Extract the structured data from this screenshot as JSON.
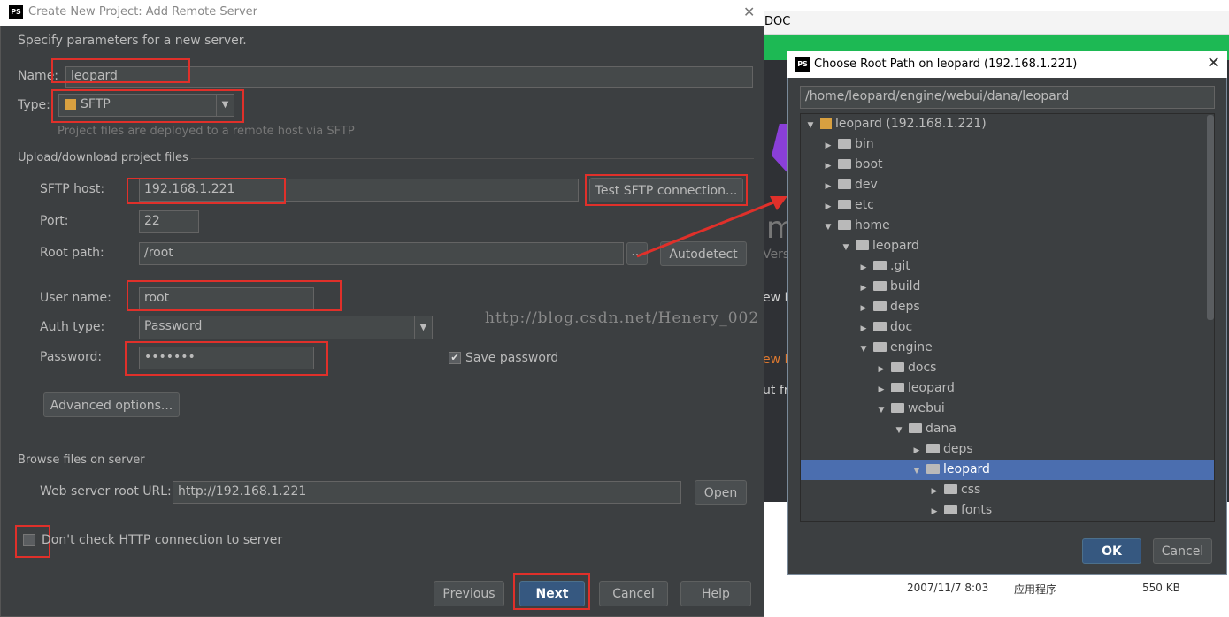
{
  "background": {
    "title_fragment": "DOC",
    "lines": [
      "mp",
      "Versi",
      "ew P",
      "ew P",
      "ut fro"
    ],
    "file_date": "2007/11/7 8:03",
    "file_kind": "应用程序",
    "file_size": "550 KB"
  },
  "dialog": {
    "title": "Create New Project: Add Remote Server",
    "app_icon": "PS",
    "header": "Specify parameters for a new server.",
    "name_label": "Name:",
    "name_value": "leopard",
    "type_label": "Type:",
    "type_value": "SFTP",
    "type_hint": "Project files are deployed to a remote host via SFTP",
    "upload_section": "Upload/download project files",
    "host_label": "SFTP host:",
    "host_value": "192.168.1.221",
    "test_button": "Test SFTP connection...",
    "port_label": "Port:",
    "port_value": "22",
    "root_label": "Root path:",
    "root_value": "/root",
    "browse_button": "...",
    "autodetect_button": "Autodetect",
    "user_label": "User name:",
    "user_value": "root",
    "auth_label": "Auth type:",
    "auth_value": "Password",
    "password_label": "Password:",
    "password_value": "•••••••",
    "save_password_label": "Save password",
    "save_password_checked": true,
    "advanced_button": "Advanced options...",
    "browse_section": "Browse files on server",
    "web_label": "Web server root URL:",
    "web_value": "http://192.168.1.221",
    "open_button": "Open",
    "dont_check_label": "Don't check HTTP connection to server",
    "dont_check_checked": false,
    "previous_button": "Previous",
    "next_button": "Next",
    "cancel_button": "Cancel",
    "help_button": "Help"
  },
  "watermark": "http://blog.csdn.net/Henery_002",
  "chooser": {
    "title": "Choose Root Path on leopard (192.168.1.221)",
    "path": "/home/leopard/engine/webui/dana/leopard",
    "tree": [
      {
        "label": "leopard (192.168.1.221)",
        "state": "open",
        "depth": 0,
        "kind": "server"
      },
      {
        "label": "bin",
        "state": "closed",
        "depth": 1
      },
      {
        "label": "boot",
        "state": "closed",
        "depth": 1
      },
      {
        "label": "dev",
        "state": "closed",
        "depth": 1
      },
      {
        "label": "etc",
        "state": "closed",
        "depth": 1
      },
      {
        "label": "home",
        "state": "open",
        "depth": 1
      },
      {
        "label": "leopard",
        "state": "open",
        "depth": 2
      },
      {
        "label": ".git",
        "state": "closed",
        "depth": 3
      },
      {
        "label": "build",
        "state": "closed",
        "depth": 3
      },
      {
        "label": "deps",
        "state": "closed",
        "depth": 3
      },
      {
        "label": "doc",
        "state": "closed",
        "depth": 3
      },
      {
        "label": "engine",
        "state": "open",
        "depth": 3
      },
      {
        "label": "docs",
        "state": "closed",
        "depth": 4
      },
      {
        "label": "leopard",
        "state": "closed",
        "depth": 4
      },
      {
        "label": "webui",
        "state": "open",
        "depth": 4
      },
      {
        "label": "dana",
        "state": "open",
        "depth": 5
      },
      {
        "label": "deps",
        "state": "closed",
        "depth": 6
      },
      {
        "label": "leopard",
        "state": "open",
        "depth": 6,
        "selected": true
      },
      {
        "label": "css",
        "state": "closed",
        "depth": 7
      },
      {
        "label": "fonts",
        "state": "closed",
        "depth": 7
      }
    ],
    "ok_button": "OK",
    "cancel_button": "Cancel"
  },
  "colors": {
    "highlight": "#e0302a",
    "selection": "#4b6eaf",
    "dialog_bg": "#3c3f41"
  }
}
